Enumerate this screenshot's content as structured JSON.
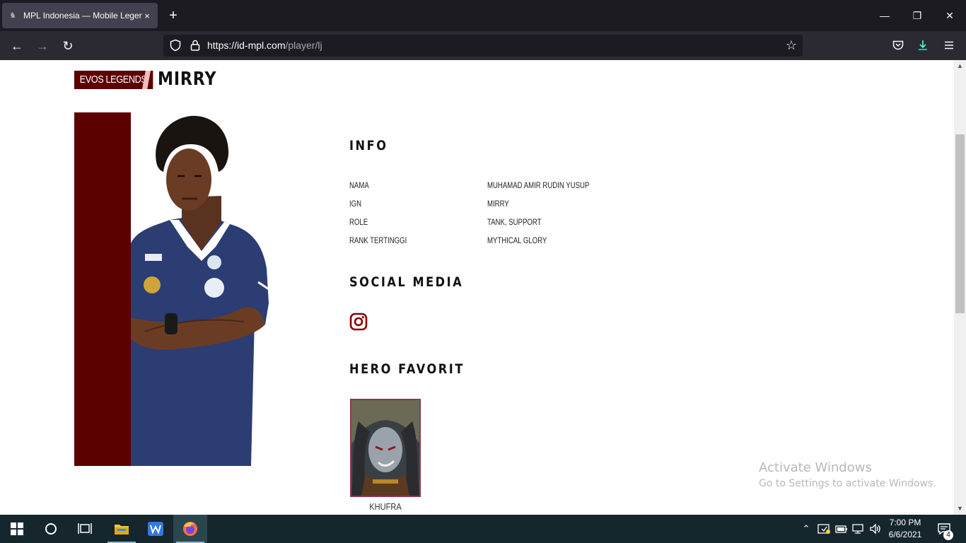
{
  "browser": {
    "tab_title": "MPL Indonesia — Mobile Legen",
    "tab_close": "×",
    "new_tab": "+",
    "url_host": "https://id-mpl.com",
    "url_path": "/player/lj"
  },
  "window_controls": {
    "minimize": "—",
    "restore": "❐",
    "close": "✕"
  },
  "nav": {
    "back": "←",
    "forward": "→",
    "reload": "↻",
    "bookmark_star": "☆"
  },
  "player": {
    "team": "EVOS LEGENDS",
    "name": "MIRRY"
  },
  "info": {
    "title": "INFO",
    "rows": [
      {
        "label": "NAMA",
        "value": "MUHAMAD AMIR RUDIN YUSUP"
      },
      {
        "label": "IGN",
        "value": "MIRRY"
      },
      {
        "label": "ROLE",
        "value": "TANK, SUPPORT"
      },
      {
        "label": "RANK TERTINGGI",
        "value": "MYTHICAL GLORY"
      }
    ]
  },
  "social": {
    "title": "SOCIAL MEDIA",
    "icon": "instagram-icon"
  },
  "hero": {
    "title": "HERO FAVORIT",
    "name": "KHUFRA"
  },
  "watermark": {
    "line1": "Activate Windows",
    "line2": "Go to Settings to activate Windows."
  },
  "taskbar": {
    "time": "7:00 PM",
    "date": "6/6/2021",
    "notification_count": "4"
  },
  "colors": {
    "accent": "#5c0000",
    "instagram": "#8b0000",
    "browser_dark": "#1c1b22",
    "taskbar": "#15262c"
  }
}
